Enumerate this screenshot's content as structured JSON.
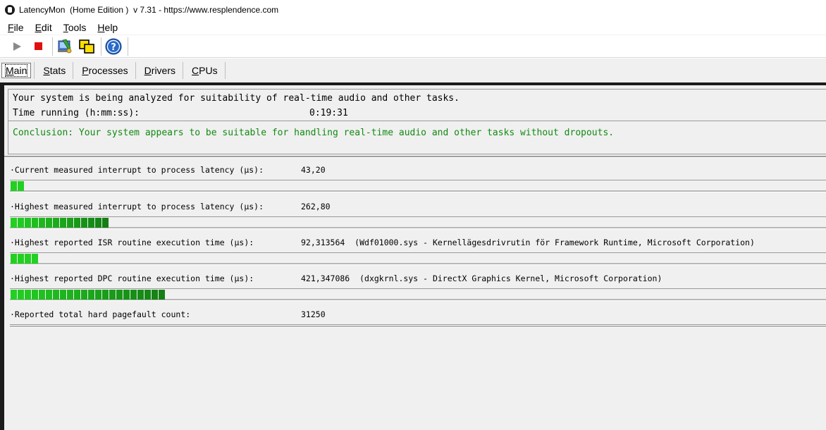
{
  "window": {
    "title": "LatencyMon  (Home Edition )  v 7.31 - https://www.resplendence.com"
  },
  "menu": [
    {
      "label": "File",
      "key": "F",
      "rest": "ile"
    },
    {
      "label": "Edit",
      "key": "E",
      "rest": "dit"
    },
    {
      "label": "Tools",
      "key": "T",
      "rest": "ools"
    },
    {
      "label": "Help",
      "key": "H",
      "rest": "elp"
    }
  ],
  "toolbar": {
    "icons": [
      "play-icon",
      "stop-icon",
      "check-drivers-icon",
      "windows-icon",
      "help-icon"
    ]
  },
  "tabs": [
    {
      "label": "Main",
      "active": true
    },
    {
      "label": "Stats",
      "active": false
    },
    {
      "label": "Processes",
      "active": false
    },
    {
      "label": "Drivers",
      "active": false
    },
    {
      "label": "CPUs",
      "active": false
    }
  ],
  "analysis": {
    "status_text": "Your system is being analyzed for suitability of real-time audio and other tasks.",
    "time_label": "Time running (h:mm:ss):",
    "time_value": "0:19:31",
    "conclusion": "Conclusion: Your system appears to be suitable for handling real-time audio and other tasks without dropouts."
  },
  "metrics": [
    {
      "label": "·Current measured interrupt to process latency (µs):",
      "value": "43,20",
      "detail": "",
      "bar_segments": 2
    },
    {
      "label": "·Highest measured interrupt to process latency (µs):",
      "value": "262,80",
      "detail": "",
      "bar_segments": 14
    },
    {
      "label": "·Highest reported ISR routine execution time (µs):",
      "value": "92,313564",
      "detail": "(Wdf01000.sys - Kernellägesdrivrutin för Framework Runtime, Microsoft Corporation)",
      "bar_segments": 4
    },
    {
      "label": "·Highest reported DPC routine execution time (µs):",
      "value": "421,347086",
      "detail": "(dxgkrnl.sys - DirectX Graphics Kernel, Microsoft Corporation)",
      "bar_segments": 22
    },
    {
      "label": "·Reported total hard pagefault count:",
      "value": "31250",
      "detail": "",
      "bar_segments": 0
    }
  ]
}
